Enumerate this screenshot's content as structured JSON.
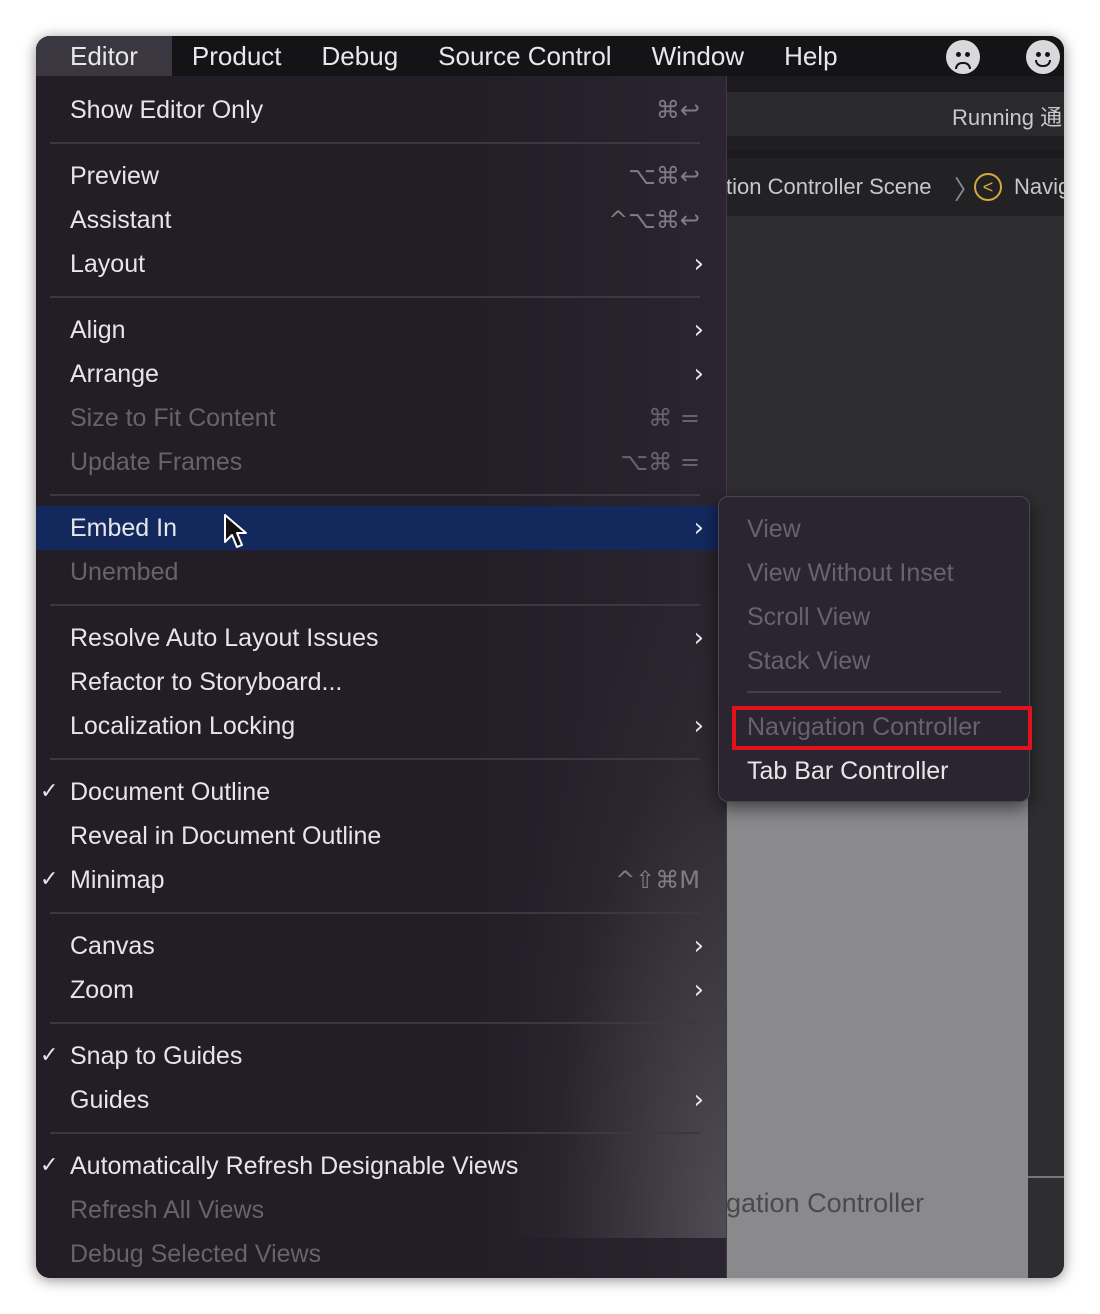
{
  "menubar": {
    "items": [
      "Editor",
      "Product",
      "Debug",
      "Source Control",
      "Window",
      "Help"
    ],
    "icons": [
      "face-frown-icon",
      "face-smile-icon"
    ]
  },
  "background": {
    "running_text": "Running 通",
    "breadcrumb": "tion Controller Scene",
    "breadcrumb_separator": "〉",
    "breadcrumb_next": "Navig",
    "nav_icon": "<",
    "canvas_label": "gation Controller"
  },
  "menu": {
    "items": [
      {
        "label": "Show Editor Only",
        "shortcut": "⌘↩"
      },
      {
        "label": "Preview",
        "shortcut": "⌥⌘↩"
      },
      {
        "label": "Assistant",
        "shortcut": "^⌥⌘↩"
      },
      {
        "label": "Layout",
        "arrow": "›"
      },
      {
        "label": "Align",
        "arrow": "›"
      },
      {
        "label": "Arrange",
        "arrow": "›"
      },
      {
        "label": "Size to Fit Content",
        "shortcut": "⌘ ="
      },
      {
        "label": "Update Frames",
        "shortcut": "⌥⌘ ="
      },
      {
        "label": "Embed In",
        "arrow": "›"
      },
      {
        "label": "Unembed"
      },
      {
        "label": "Resolve Auto Layout Issues",
        "arrow": "›"
      },
      {
        "label": "Refactor to Storyboard..."
      },
      {
        "label": "Localization Locking",
        "arrow": "›"
      },
      {
        "label": "Document Outline",
        "check": "✓"
      },
      {
        "label": "Reveal in Document Outline"
      },
      {
        "label": "Minimap",
        "check": "✓",
        "shortcut": "^⇧⌘M"
      },
      {
        "label": "Canvas",
        "arrow": "›"
      },
      {
        "label": "Zoom",
        "arrow": "›"
      },
      {
        "label": "Snap to Guides",
        "check": "✓"
      },
      {
        "label": "Guides",
        "arrow": "›"
      },
      {
        "label": "Automatically Refresh Designable Views",
        "check": "✓"
      },
      {
        "label": "Refresh All Views"
      },
      {
        "label": "Debug Selected Views"
      }
    ]
  },
  "submenu": {
    "items": [
      "View",
      "View Without Inset",
      "Scroll View",
      "Stack View",
      "Navigation Controller",
      "Tab Bar Controller"
    ]
  },
  "colors": {
    "highlight": "#13295e",
    "annotation_box": "#e0131d"
  }
}
